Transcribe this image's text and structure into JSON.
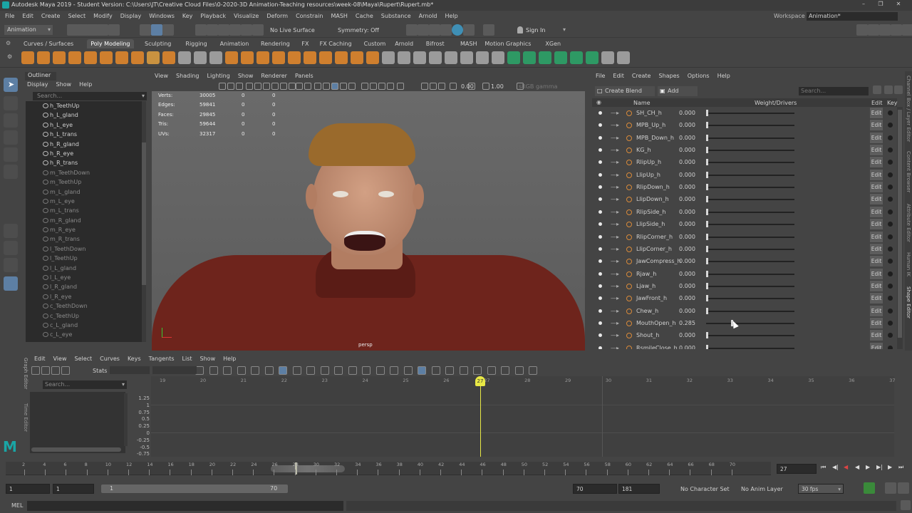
{
  "title_bar": {
    "text": "Autodesk Maya 2019 - Student Version: C:\\Users\\JT\\Creative Cloud Files\\0-2020-3D Animation-Teaching resources\\week-08\\Maya\\Rupert\\Rupert.mb*",
    "workspace_label": "Workspace :",
    "workspace_value": "Animation*"
  },
  "menu": [
    "File",
    "Edit",
    "Create",
    "Select",
    "Modify",
    "Display",
    "Windows",
    "Key",
    "Playback",
    "Visualize",
    "Deform",
    "Constrain",
    "MASH",
    "Cache",
    "Substance",
    "Arnold",
    "Help"
  ],
  "status_line": {
    "mode": "Animation",
    "live_surface": "No Live Surface",
    "symmetry": "Symmetry: Off",
    "sign_in": "Sign In"
  },
  "shelf_tabs": [
    "Curves / Surfaces",
    "Poly Modeling",
    "Sculpting",
    "Rigging",
    "Animation",
    "Rendering",
    "FX",
    "FX Caching",
    "Custom",
    "Arnold",
    "Bifrost",
    "MASH",
    "Motion Graphics",
    "XGen"
  ],
  "shelf_active": "Poly Modeling",
  "outliner": {
    "tab": "Outliner",
    "menu": [
      "Display",
      "Show",
      "Help"
    ],
    "search_placeholder": "Search...",
    "items": [
      {
        "n": "h_TeethUp",
        "d": false
      },
      {
        "n": "h_L_gland",
        "d": false
      },
      {
        "n": "h_L_eye",
        "d": false
      },
      {
        "n": "h_L_trans",
        "d": false
      },
      {
        "n": "h_R_gland",
        "d": false
      },
      {
        "n": "h_R_eye",
        "d": false
      },
      {
        "n": "h_R_trans",
        "d": false
      },
      {
        "n": "m_TeethDown",
        "d": true
      },
      {
        "n": "m_TeethUp",
        "d": true
      },
      {
        "n": "m_L_gland",
        "d": true
      },
      {
        "n": "m_L_eye",
        "d": true
      },
      {
        "n": "m_L_trans",
        "d": true
      },
      {
        "n": "m_R_gland",
        "d": true
      },
      {
        "n": "m_R_eye",
        "d": true
      },
      {
        "n": "m_R_trans",
        "d": true
      },
      {
        "n": "l_TeethDown",
        "d": true
      },
      {
        "n": "l_TeethUp",
        "d": true
      },
      {
        "n": "l_L_gland",
        "d": true
      },
      {
        "n": "l_L_eye",
        "d": true
      },
      {
        "n": "l_R_gland",
        "d": true
      },
      {
        "n": "l_R_eye",
        "d": true
      },
      {
        "n": "c_TeethDown",
        "d": true
      },
      {
        "n": "c_TeethUp",
        "d": true
      },
      {
        "n": "c_L_gland",
        "d": true
      },
      {
        "n": "c_L_eye",
        "d": true
      }
    ]
  },
  "viewport": {
    "menu": [
      "View",
      "Shading",
      "Lighting",
      "Show",
      "Renderer",
      "Panels"
    ],
    "hud": [
      {
        "l": "Verts:",
        "a": "30005",
        "b": "0",
        "c": "0"
      },
      {
        "l": "Edges:",
        "a": "59841",
        "b": "0",
        "c": "0"
      },
      {
        "l": "Faces:",
        "a": "29845",
        "b": "0",
        "c": "0"
      },
      {
        "l": "Tris:",
        "a": "59644",
        "b": "0",
        "c": "0"
      },
      {
        "l": "UVs:",
        "a": "32317",
        "b": "0",
        "c": "0"
      }
    ],
    "camera": "persp",
    "val1": "0.00",
    "val2": "1.00",
    "gamma": "sRGB gamma"
  },
  "shape_editor": {
    "menu": [
      "File",
      "Edit",
      "Create",
      "Shapes",
      "Options",
      "Help"
    ],
    "create_btn": "Create Blend Shape",
    "add_btn": "Add Target",
    "search_placeholder": "Search...",
    "col_name": "Name",
    "col_weight": "Weight/Drivers",
    "col_edit": "Edit",
    "col_key": "Key",
    "edit_label": "Edit",
    "rows": [
      {
        "n": "SH_CH_h",
        "w": "0.000",
        "f": 0
      },
      {
        "n": "MPB_Up_h",
        "w": "0.000",
        "f": 0
      },
      {
        "n": "MPB_Down_h",
        "w": "0.000",
        "f": 0
      },
      {
        "n": "KG_h",
        "w": "0.000",
        "f": 0
      },
      {
        "n": "RlipUp_h",
        "w": "0.000",
        "f": 0
      },
      {
        "n": "LlipUp_h",
        "w": "0.000",
        "f": 0
      },
      {
        "n": "RlipDown_h",
        "w": "0.000",
        "f": 0
      },
      {
        "n": "LlipDown_h",
        "w": "0.000",
        "f": 0
      },
      {
        "n": "RlipSide_h",
        "w": "0.000",
        "f": 0
      },
      {
        "n": "LlipSide_h",
        "w": "0.000",
        "f": 0
      },
      {
        "n": "RlipCorner_h",
        "w": "0.000",
        "f": 0
      },
      {
        "n": "LlipCorner_h",
        "w": "0.000",
        "f": 0
      },
      {
        "n": "JawCompress_h",
        "w": "0.000",
        "f": 0
      },
      {
        "n": "Rjaw_h",
        "w": "0.000",
        "f": 0
      },
      {
        "n": "Ljaw_h",
        "w": "0.000",
        "f": 0
      },
      {
        "n": "JawFront_h",
        "w": "0.000",
        "f": 0
      },
      {
        "n": "Chew_h",
        "w": "0.000",
        "f": 0
      },
      {
        "n": "MouthOpen_h",
        "w": "0.285",
        "f": 0.285
      },
      {
        "n": "Shout_h",
        "w": "0.000",
        "f": 0
      },
      {
        "n": "RsmileClose_h",
        "w": "0.000",
        "f": 0
      }
    ]
  },
  "right_tabs": [
    "Channel Box / Layer Editor",
    "Content Browser",
    "Attribute Editor",
    "Human IK",
    "Shape Editor"
  ],
  "graph_editor": {
    "menu": [
      "Edit",
      "View",
      "Select",
      "Curves",
      "Keys",
      "Tangents",
      "List",
      "Show",
      "Help"
    ],
    "stats_label": "Stats",
    "search_placeholder": "Search...",
    "side_label": "Graph Editor",
    "time_label": "Time Editor",
    "frames": [
      "19",
      "20",
      "21",
      "22",
      "23",
      "24",
      "25",
      "26",
      "27",
      "28",
      "29",
      "30",
      "31",
      "32",
      "33",
      "34",
      "35",
      "36",
      "37"
    ],
    "current": "27",
    "yvals": [
      "1.25",
      "1",
      "0.75",
      "0.5",
      "0.25",
      "0",
      "-0.25",
      "-0.5",
      "-0.75"
    ]
  },
  "timeline": {
    "ticks": [
      "2",
      "4",
      "6",
      "8",
      "10",
      "12",
      "14",
      "16",
      "18",
      "20",
      "22",
      "24",
      "26",
      "28",
      "30",
      "32",
      "34",
      "36",
      "38",
      "40",
      "42",
      "44",
      "46",
      "48",
      "50",
      "52",
      "54",
      "56",
      "58",
      "60",
      "62",
      "64",
      "66",
      "68",
      "70"
    ],
    "current_frame": "27",
    "range_start": "1",
    "range_start2": "1",
    "range_inner_start": "1",
    "range_inner_end": "70",
    "anim_end": "70",
    "anim_end2": "181",
    "character_set": "No Character Set",
    "anim_layer": "No Anim Layer",
    "fps": "30 fps"
  },
  "command_line": {
    "label": "MEL"
  }
}
